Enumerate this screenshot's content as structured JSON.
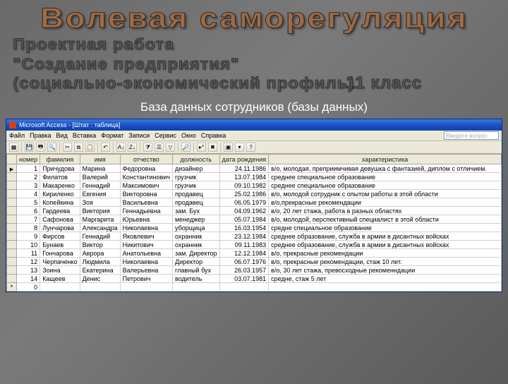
{
  "heading": {
    "title": "Волевая саморегуляция",
    "line1": "Проектная работа",
    "line2": "\"Создание предприятия\"",
    "line3": "(социально-экономический профиль)",
    "grade": "11 класс",
    "caption": "База данных сотрудников (базы данных)"
  },
  "window": {
    "title": "Microsoft Access - [Штат : таблица]",
    "help_placeholder": "Введите вопрос",
    "menu": [
      "Файл",
      "Правка",
      "Вид",
      "Вставка",
      "Формат",
      "Записи",
      "Сервис",
      "Окно",
      "Справка"
    ],
    "columns": [
      "номер",
      "фамилия",
      "имя",
      "отчество",
      "должность",
      "дата рождения",
      "характеристика"
    ]
  },
  "rows": [
    {
      "n": "1",
      "fam": "Причудова",
      "name": "Марина",
      "otch": "Федоровна",
      "pos": "дизайнер",
      "date": "24.11.1986",
      "char": "в/о, молодая, преприимчивая девушка с фантазией, диплом с отличием."
    },
    {
      "n": "2",
      "fam": "Филатов",
      "name": "Валерий",
      "otch": "Константинович",
      "pos": "грузчик",
      "date": "13.07.1984",
      "char": "среднее специальное образование"
    },
    {
      "n": "3",
      "fam": "Макаренко",
      "name": "Геннадий",
      "otch": "Максимович",
      "pos": "грузчик",
      "date": "09.10.1982",
      "char": "среднее специальное образование"
    },
    {
      "n": "4",
      "fam": "Кириленко",
      "name": "Евгения",
      "otch": "Викторовна",
      "pos": "продавец",
      "date": "25.02.1986",
      "char": "в/о, молодой сотрудник с опытом работы в этой области"
    },
    {
      "n": "5",
      "fam": "Копейкина",
      "name": "Зоя",
      "otch": "Васильевна",
      "pos": "продавец",
      "date": "06.05.1979",
      "char": "в/о,прекрасные рекомендации"
    },
    {
      "n": "6",
      "fam": "Гардеева",
      "name": "Виктория",
      "otch": "Геннадьевна",
      "pos": "зам. Бух",
      "date": "04.09.1962",
      "char": "в/о, 20 лет стажа, работа в разных областях"
    },
    {
      "n": "7",
      "fam": "Сафонова",
      "name": "Маргарита",
      "otch": "Юрьевна",
      "pos": "менеджер",
      "date": "05.07.1984",
      "char": "в/о, молодой, перспективный специалист в этой области"
    },
    {
      "n": "8",
      "fam": "Лунчарова",
      "name": "Александра",
      "otch": "Николаевна",
      "pos": "уборщица",
      "date": "16.03.1954",
      "char": "средне специальное образование"
    },
    {
      "n": "9",
      "fam": "Фирсов",
      "name": "Геннадий",
      "otch": "Яковлевич",
      "pos": "охранник",
      "date": "23.12.1984",
      "char": "среднее образование, служба в армии в дисантных войсках"
    },
    {
      "n": "10",
      "fam": "Бунаев",
      "name": "Виктор",
      "otch": "Никитович",
      "pos": "охранник",
      "date": "09.11.1983",
      "char": "среднее образование, служба в армии в дисантных войсках"
    },
    {
      "n": "11",
      "fam": "Гончарова",
      "name": "Аврора",
      "otch": "Анатольевна",
      "pos": "зам. Директор",
      "date": "12.12.1984",
      "char": "в/о, прекрасные рекомендации"
    },
    {
      "n": "12",
      "fam": "Черпаченко",
      "name": "Людмила",
      "otch": "Николаевна",
      "pos": "Директор",
      "date": "06.07.1976",
      "char": "в/о, прекрасные рекомендации, стаж 10 лет."
    },
    {
      "n": "13",
      "fam": "Зоина",
      "name": "Екатерина",
      "otch": "Валерьевна",
      "pos": "главный бух",
      "date": "26.03.1957",
      "char": "в/о, 30 лет стажа, превосходные рекоменндации"
    },
    {
      "n": "14",
      "fam": "Кащеев",
      "name": "Денис",
      "otch": "Петрович",
      "pos": "водитель",
      "date": "03.07.1981",
      "char": "средне, стаж 5 лет"
    }
  ],
  "newrow_n": "0"
}
